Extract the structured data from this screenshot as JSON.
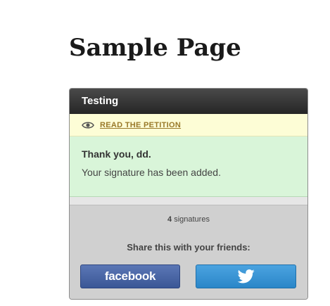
{
  "page": {
    "title": "Sample Page"
  },
  "widget": {
    "header_title": "Testing",
    "petition_link_label": "READ THE PETITION",
    "petition_icon": "eye-icon",
    "thanks_title": "Thank you, dd.",
    "thanks_message": "Your signature has been added.",
    "signature_count": "4",
    "signature_label": "signatures",
    "share_label": "Share this with your friends:",
    "facebook_label": "facebook",
    "twitter_icon": "twitter-bird-icon"
  },
  "colors": {
    "header_bg": "#2e2e2e",
    "petition_bar_bg": "#fdfdd6",
    "petition_link": "#9a7a2a",
    "thanks_bg": "#d9f5d9",
    "footer_bg": "#d0d0d0",
    "facebook_blue": "#3b5998",
    "twitter_blue": "#2a86c8"
  }
}
